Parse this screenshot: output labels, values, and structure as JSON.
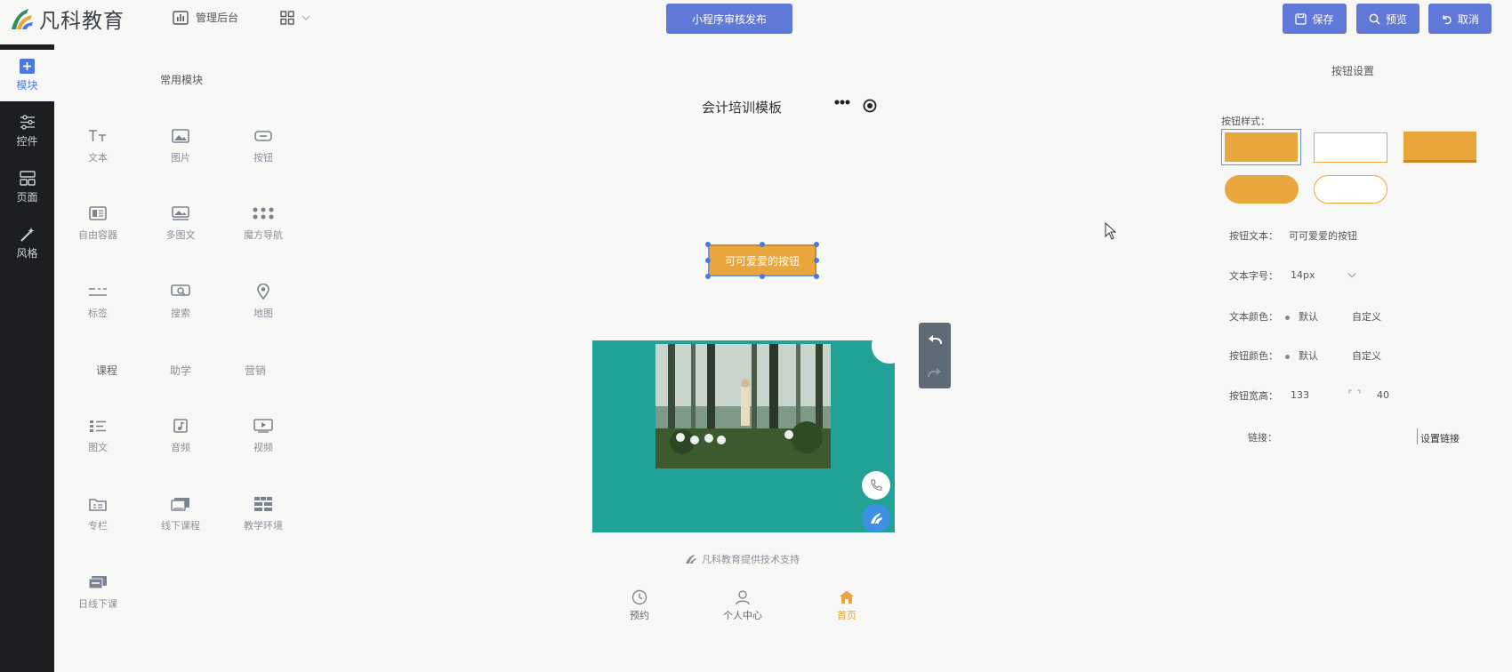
{
  "colors": {
    "accent": "#6079d8",
    "button_orange": "#e9a63c",
    "banner_teal": "#22a296",
    "nav_dark": "#1c1e22",
    "active_blue": "#4a7ae0"
  },
  "header": {
    "logo_text": "凡科教育",
    "admin_label": "管理后台",
    "publish_label": "小程序审核发布",
    "save_label": "保存",
    "preview_label": "预览",
    "cancel_label": "取消"
  },
  "leftnav": {
    "items": [
      {
        "label": "模块",
        "icon": "plus-square-icon",
        "active": true
      },
      {
        "label": "控件",
        "icon": "sliders-icon"
      },
      {
        "label": "页面",
        "icon": "layout-icon"
      },
      {
        "label": "风格",
        "icon": "magic-wand-icon"
      }
    ]
  },
  "modules": {
    "title": "常用模块",
    "common": [
      {
        "label": "文本",
        "icon": "text-icon"
      },
      {
        "label": "图片",
        "icon": "image-icon"
      },
      {
        "label": "按钮",
        "icon": "button-icon"
      },
      {
        "label": "自由容器",
        "icon": "container-icon"
      },
      {
        "label": "多图文",
        "icon": "multi-image-icon"
      },
      {
        "label": "魔方导航",
        "icon": "grid-dots-icon"
      },
      {
        "label": "标签",
        "icon": "tag-icon"
      },
      {
        "label": "搜索",
        "icon": "search-icon"
      },
      {
        "label": "地图",
        "icon": "map-pin-icon"
      }
    ],
    "categories": [
      "课程",
      "助学",
      "营销"
    ],
    "course": [
      {
        "label": "图文",
        "icon": "list-icon"
      },
      {
        "label": "音频",
        "icon": "music-icon"
      },
      {
        "label": "视频",
        "icon": "video-icon"
      },
      {
        "label": "专栏",
        "icon": "folder-icon"
      },
      {
        "label": "线下课程",
        "icon": "offline-course-icon"
      },
      {
        "label": "教学环境",
        "icon": "grid-icon"
      },
      {
        "label": "日线下课",
        "icon": "offline-class-icon"
      }
    ]
  },
  "canvas": {
    "template_title": "会计培训模板",
    "selected_button_text": "可可爱爱的按钮",
    "support_text": "凡科教育提供技术支持",
    "tabs": [
      {
        "label": "预约",
        "icon": "clock-icon"
      },
      {
        "label": "个人中心",
        "icon": "user-icon"
      },
      {
        "label": "首页",
        "icon": "home-icon",
        "active": true
      }
    ]
  },
  "settings": {
    "title": "按钮设置",
    "style_label": "按钮样式：",
    "text_label": "按钮文本：",
    "text_value": "可可爱爱的按钮",
    "size_label": "文本字号：",
    "size_value": "14px",
    "text_color_label": "文本颜色：",
    "btn_color_label": "按钮颜色：",
    "default_label": "默认",
    "custom_label": "自定义",
    "width_label": "按钮宽高：",
    "width_value": "133",
    "height_value": "40",
    "link_label": "链接：",
    "link_action": "设置链接"
  }
}
